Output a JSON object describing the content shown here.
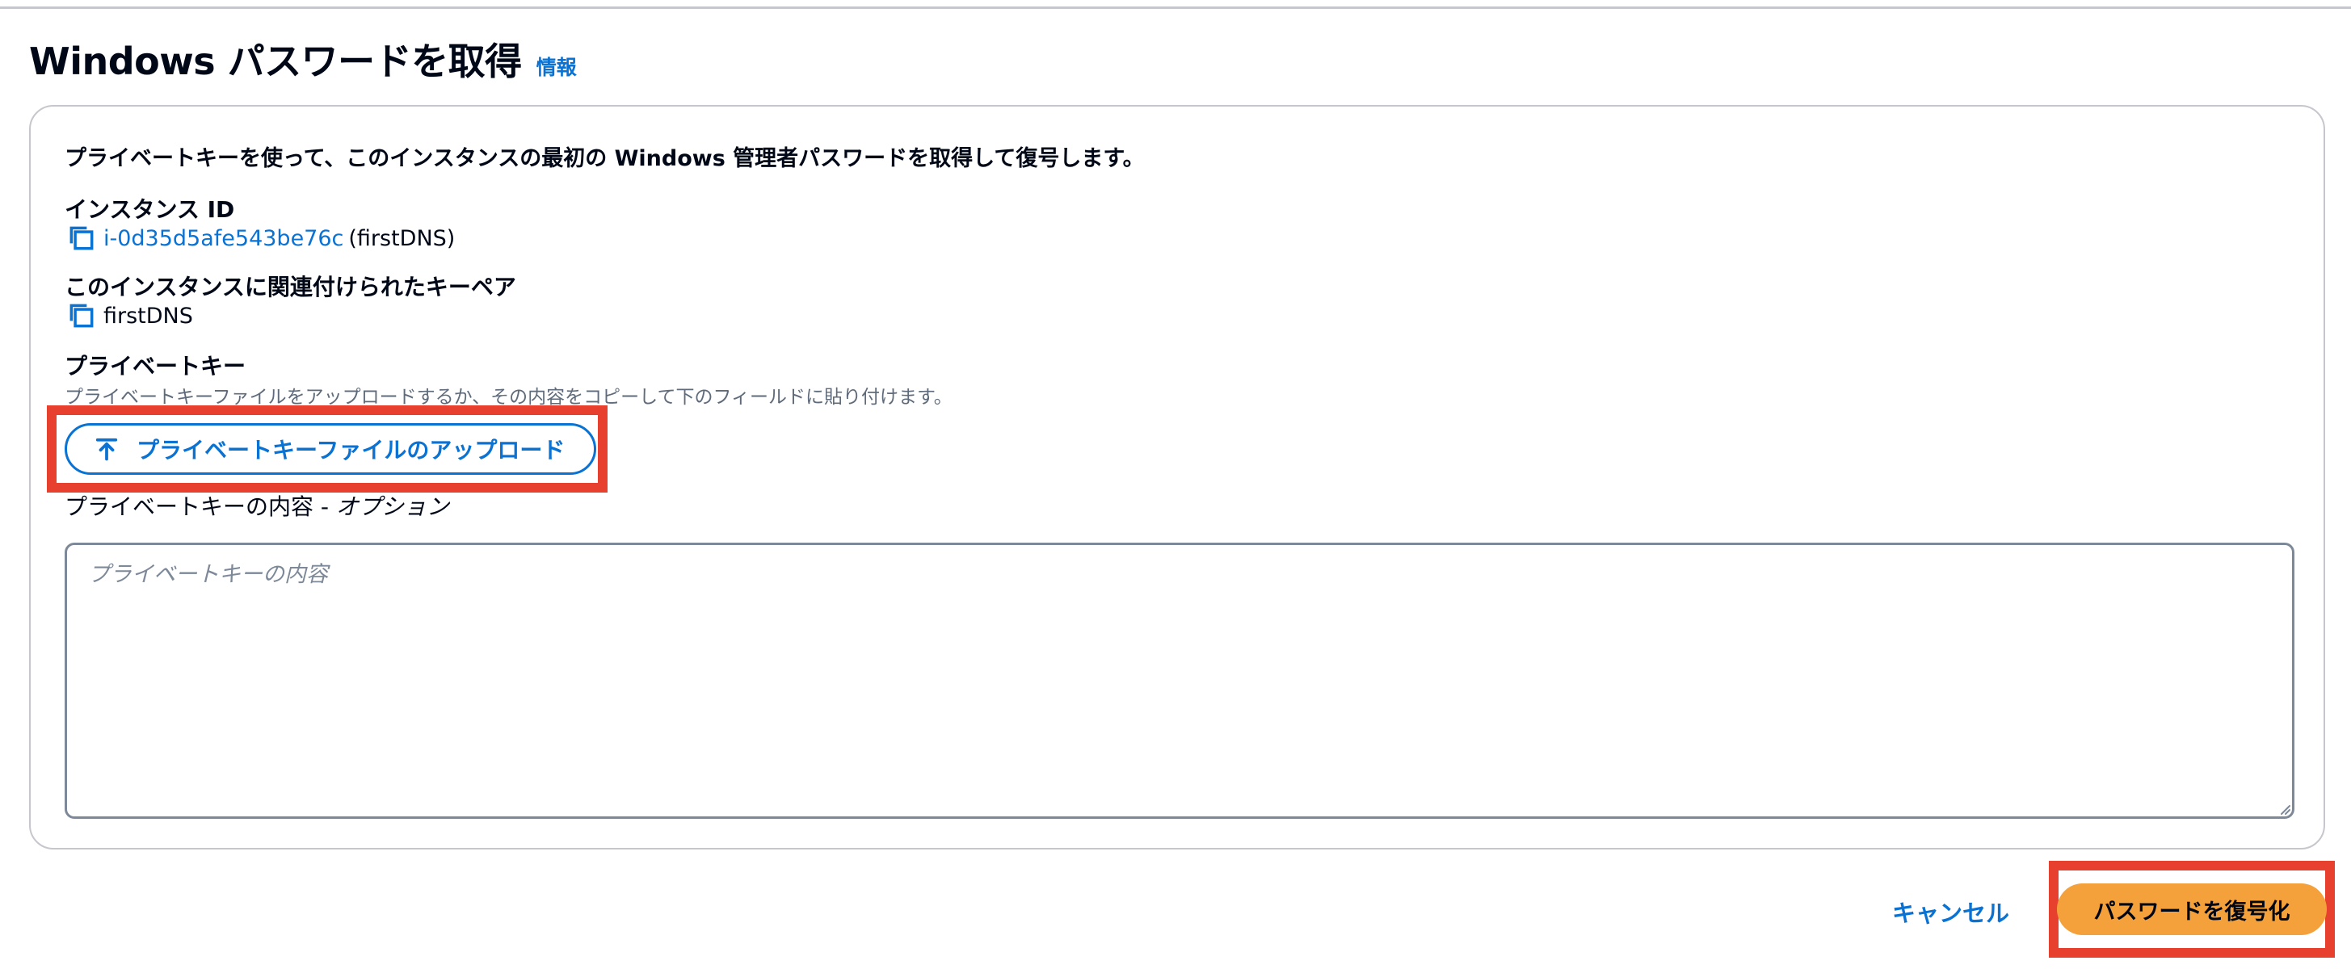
{
  "header": {
    "title": "Windows パスワードを取得",
    "info_link": "情報"
  },
  "panel": {
    "description": "プライベートキーを使って、このインスタンスの最初の Windows 管理者パスワードを取得して復号します。",
    "instance": {
      "label": "インスタンス ID",
      "id": "i-0d35d5afe543be76c",
      "suffix": "(firstDNS)"
    },
    "keypair": {
      "label": "このインスタンスに関連付けられたキーペア",
      "value": "firstDNS"
    },
    "private_key": {
      "label": "プライベートキー",
      "help": "プライベートキーファイルをアップロードするか、その内容をコピーして下のフィールドに貼り付けます。",
      "upload_label": "プライベートキーファイルのアップロード",
      "content_label": "プライベートキーの内容 -",
      "content_optional": "オプション",
      "placeholder": "プライベートキーの内容",
      "value": ""
    }
  },
  "footer": {
    "cancel_label": "キャンセル",
    "decrypt_label": "パスワードを復号化"
  },
  "colors": {
    "link": "#0972d3",
    "primary_button": "#f4a13b",
    "highlight": "#e8402f",
    "border": "#c6c6cd"
  },
  "icons": {
    "copy": "copy-icon",
    "upload": "upload-icon"
  }
}
